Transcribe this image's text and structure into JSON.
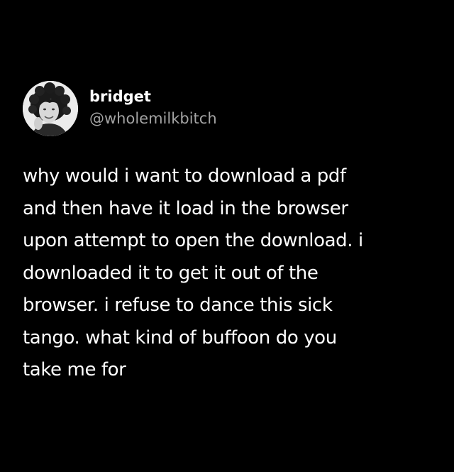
{
  "author": {
    "display_name": "bridget",
    "handle": "@wholemilkbitch",
    "avatar_icon": "profile-photo-avatar"
  },
  "tweet": {
    "lines": [
      "why would i want to download a pdf",
      "and then have it load in the browser",
      "upon attempt to open the download. i",
      "downloaded it to get it out of the",
      "browser. i refuse to dance this sick",
      "tango. what kind of buffoon do you",
      "take me for"
    ]
  },
  "colors": {
    "background": "#000000",
    "text": "#ffffff",
    "handle": "#a3a3a3"
  }
}
